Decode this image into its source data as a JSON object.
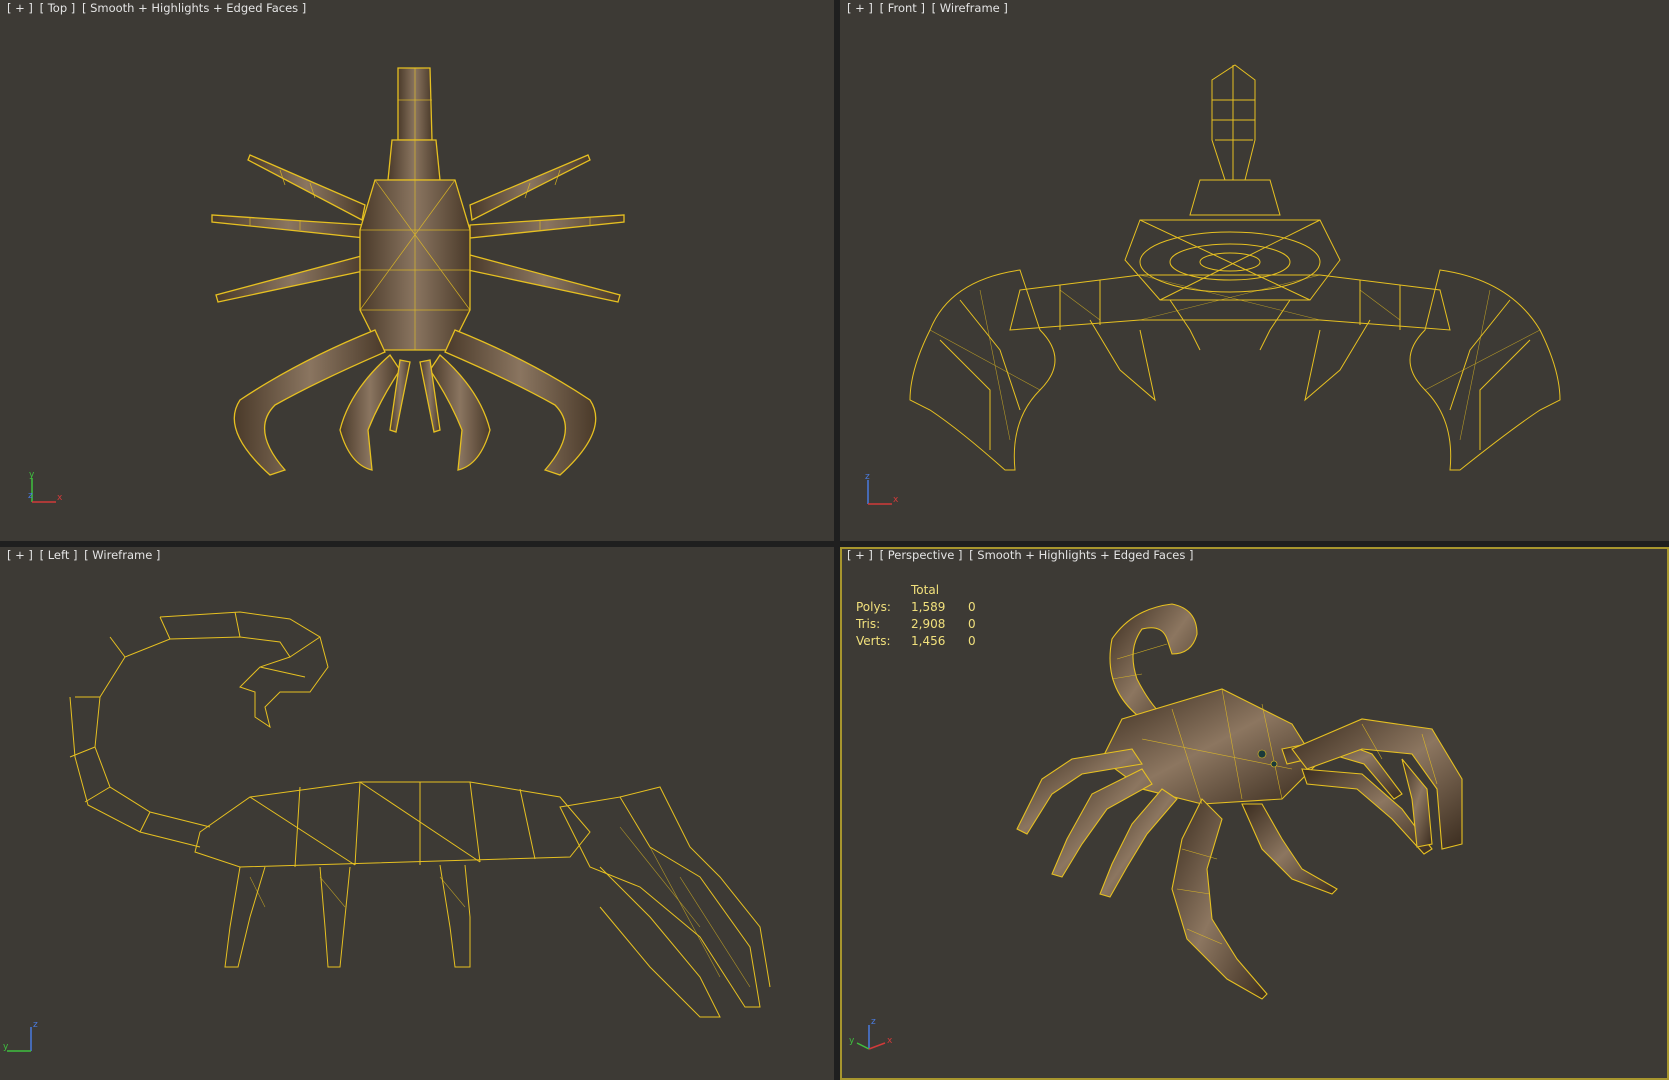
{
  "viewports": {
    "top": {
      "plus": "[ + ]",
      "view": "[ Top ]",
      "mode": "[ Smooth + Highlights + Edged Faces ]"
    },
    "front": {
      "plus": "[ + ]",
      "view": "[ Front ]",
      "mode": "[ Wireframe ]"
    },
    "left": {
      "plus": "[ + ]",
      "view": "[ Left ]",
      "mode": "[ Wireframe ]"
    },
    "perspective": {
      "plus": "[ + ]",
      "view": "[ Perspective ]",
      "mode": "[ Smooth + Highlights + Edged Faces ]",
      "active": true
    }
  },
  "stats": {
    "header": "Total",
    "rows": [
      {
        "label": "Polys:",
        "total": "1,589",
        "selected": "0"
      },
      {
        "label": "Tris:",
        "total": "2,908",
        "selected": "0"
      },
      {
        "label": "Verts:",
        "total": "1,456",
        "selected": "0"
      }
    ]
  },
  "axes": {
    "top": {
      "a": "y",
      "b": "z",
      "c": "x"
    },
    "front": {
      "a": "z",
      "b": "x"
    },
    "left": {
      "a": "z",
      "b": "y"
    },
    "persp": {
      "a": "z",
      "b": "y",
      "c": "x"
    }
  },
  "colors": {
    "viewport_bg": "#3d3a35",
    "wire": "#e6c021",
    "active_border": "#a8962e",
    "stats_text": "#f1e07c"
  }
}
